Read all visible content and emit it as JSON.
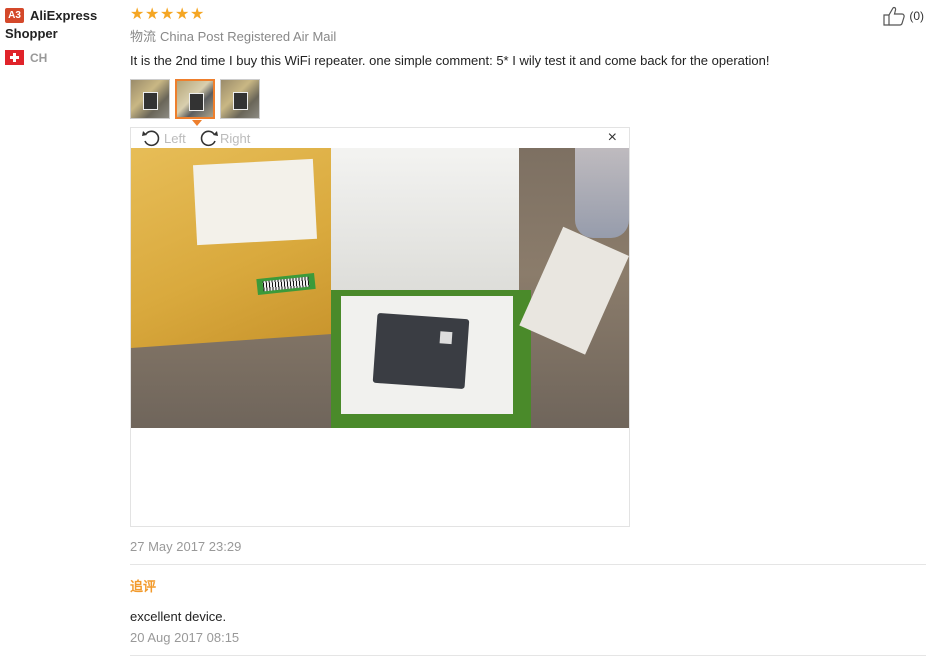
{
  "user": {
    "level_badge": "A3",
    "name_line1": "AliExpress",
    "name_line2": "Shopper",
    "country_code": "CH",
    "flag_color": "#e0232a"
  },
  "review": {
    "rating": 5,
    "stars": "★★★★★",
    "shipping_label": "物流",
    "shipping_method": "China Post Registered Air Mail",
    "comment": "It is the 2nd time I buy this WiFi repeater. one simple comment: 5* I wily test it and come back for the operation!",
    "helpful_count": "(0)",
    "images": [
      {
        "name": "photo-1"
      },
      {
        "name": "photo-2",
        "selected": true
      },
      {
        "name": "photo-3"
      }
    ],
    "viewer": {
      "rotate_left_label": "Left",
      "rotate_right_label": "Right",
      "close_label": "×"
    },
    "date": "27 May 2017 23:29"
  },
  "followup": {
    "title": "追评",
    "text": "excellent device.",
    "date": "20 Aug 2017 08:15"
  },
  "colors": {
    "star": "#f5a623",
    "accent_orange": "#ee7f2d",
    "followup_title": "#f29a2c",
    "badge_red": "#d4482a"
  }
}
